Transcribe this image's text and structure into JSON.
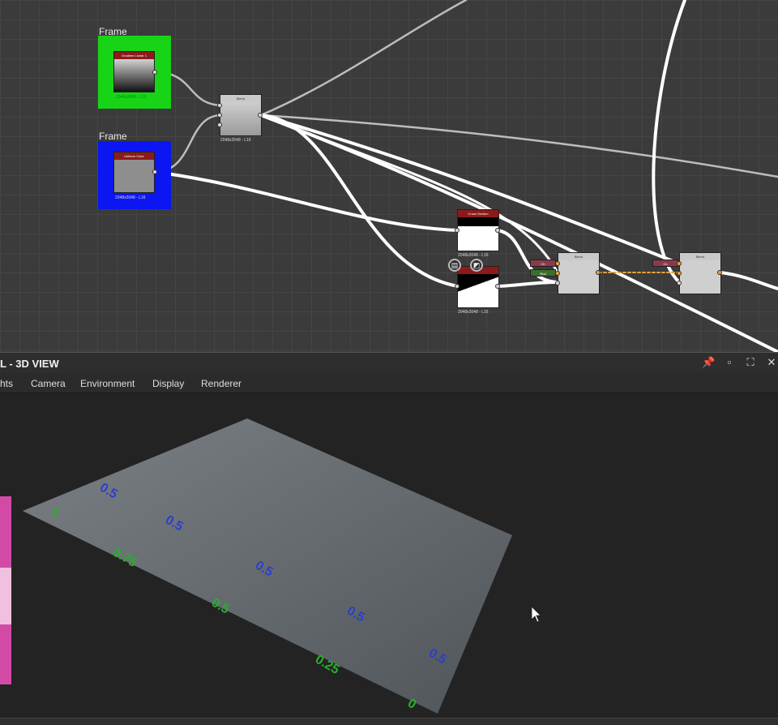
{
  "graph": {
    "frames": [
      {
        "label": "Frame",
        "color": "#17d417",
        "node_title": "Gradient Linear 1",
        "node_sub": "2048x2048 - L16"
      },
      {
        "label": "Frame",
        "color": "#0b16f2",
        "node_title": "Uniform Color",
        "node_sub": "2048x2048 - L16"
      }
    ],
    "blend1": {
      "title": "Blend",
      "sub": "2048x2048 - L16"
    },
    "cross_section": {
      "title": "Cross Section",
      "sub": "2048x2048 - L16"
    },
    "shape": {
      "title": "",
      "sub": "2048x2048 - L16"
    },
    "blend2": {
      "title": "Blend",
      "tag_a": "Ch",
      "tag_b": "Rnd"
    },
    "blend3": {
      "title": "Blend",
      "tag_a": "Ch"
    }
  },
  "panel": {
    "title": "L - 3D VIEW",
    "icons": [
      "pin-icon",
      "restore-icon",
      "maximize-icon",
      "close-icon"
    ],
    "icon_glyphs": [
      "📌",
      "▫",
      "⛶",
      "✕"
    ]
  },
  "menu": {
    "items": [
      "hts",
      "Camera",
      "Environment",
      "Display",
      "Renderer"
    ]
  },
  "viewport": {
    "green_labels": [
      "1",
      "0.75",
      "0.5",
      "0.25",
      "0"
    ],
    "blue_labels": [
      "0.5",
      "0.5",
      "0.5",
      "0.5",
      "0.5"
    ],
    "green_color": "#28b028",
    "blue_color": "#2c3fc7"
  }
}
